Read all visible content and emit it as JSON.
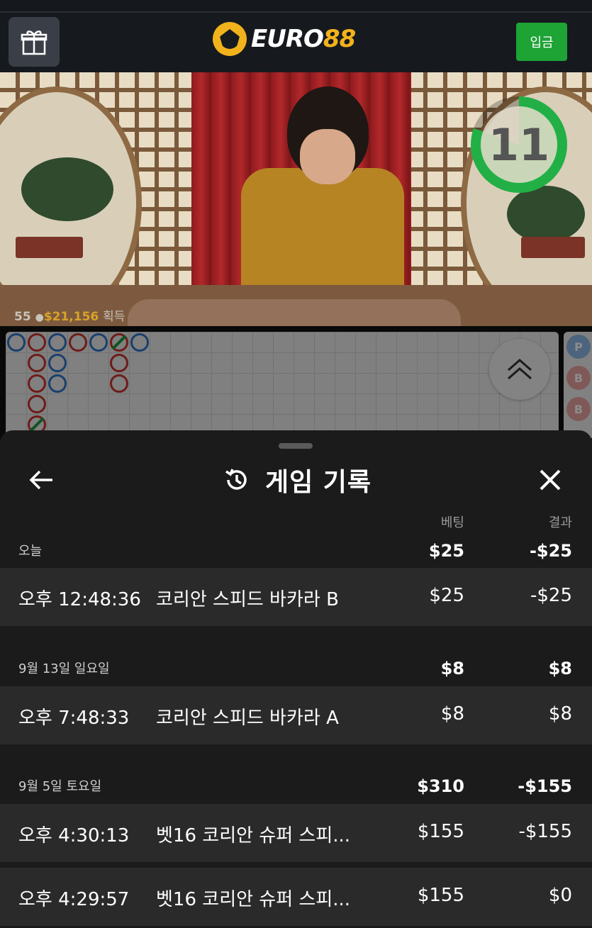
{
  "header": {
    "logo_brand": "EURO",
    "logo_number": "88",
    "deposit_label": "입금"
  },
  "video": {
    "countdown": "11",
    "players_count": "55",
    "win_amount": "$21,156",
    "win_suffix": "획득"
  },
  "panel": {
    "title": "게임 기록",
    "col_bet": "베팅",
    "col_result": "결과",
    "sections": [
      {
        "date": "오늘",
        "bet": "$25",
        "result": "-$25",
        "rows": [
          {
            "time": "오후 12:48:36",
            "game": "코리안 스피드 바카라 B",
            "bet": "$25",
            "result": "-$25"
          }
        ]
      },
      {
        "date": "9월 13일 일요일",
        "bet": "$8",
        "result": "$8",
        "rows": [
          {
            "time": "오후 7:48:33",
            "game": "코리안 스피드 바카라 A",
            "bet": "$8",
            "result": "$8"
          }
        ]
      },
      {
        "date": "9월 5일 토요일",
        "bet": "$310",
        "result": "-$155",
        "rows": [
          {
            "time": "오후 4:30:13",
            "game": "벳16 코리안 슈퍼 스피...",
            "bet": "$155",
            "result": "-$155"
          },
          {
            "time": "오후 4:29:57",
            "game": "벳16 코리안 슈퍼 스피...",
            "bet": "$155",
            "result": "$0"
          }
        ]
      }
    ]
  },
  "side_board": [
    "P",
    "B",
    "B"
  ],
  "colors": {
    "accent_gold": "#f2b21c",
    "deposit_green": "#1ea335",
    "banker_red": "#c9332f",
    "player_blue": "#2f73c9",
    "tie_green": "#1e9a3e"
  }
}
